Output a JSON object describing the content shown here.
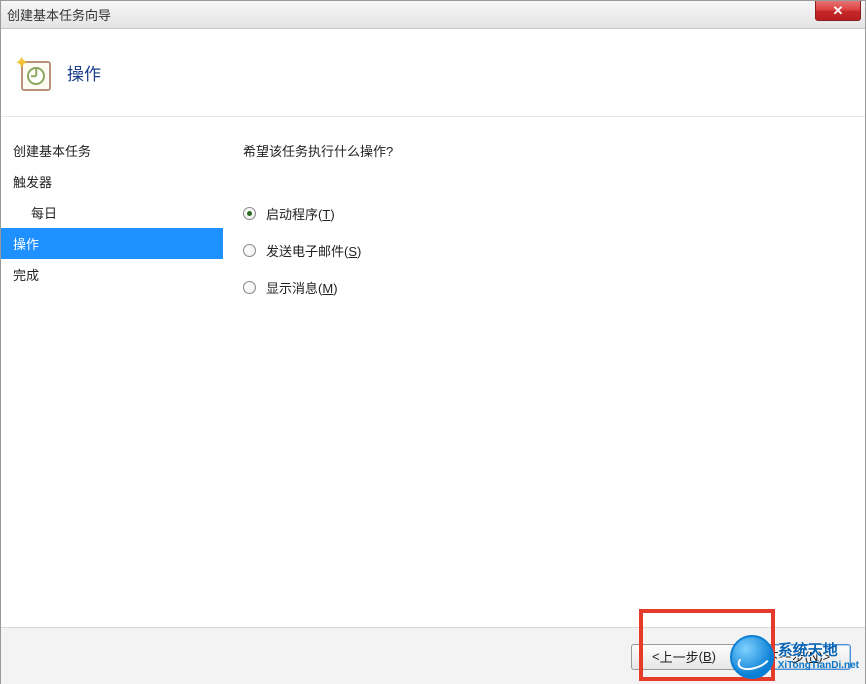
{
  "window": {
    "title": "创建基本任务向导"
  },
  "close_btn_glyph": "✕",
  "header": {
    "page_title": "操作"
  },
  "sidebar": {
    "items": [
      {
        "label": "创建基本任务",
        "sub": false,
        "active": false
      },
      {
        "label": "触发器",
        "sub": false,
        "active": false
      },
      {
        "label": "每日",
        "sub": true,
        "active": false
      },
      {
        "label": "操作",
        "sub": false,
        "active": true
      },
      {
        "label": "完成",
        "sub": false,
        "active": false
      }
    ]
  },
  "content": {
    "prompt": "希望该任务执行什么操作?",
    "options": [
      {
        "label": "启动程序",
        "accel": "T",
        "checked": true
      },
      {
        "label": "发送电子邮件",
        "accel": "S",
        "checked": false
      },
      {
        "label": "显示消息",
        "accel": "M",
        "checked": false
      }
    ]
  },
  "footer": {
    "back": {
      "prefix": "< ",
      "label": "上一步",
      "accel": "B",
      "suffix": ""
    },
    "next": {
      "prefix": "",
      "label": "下一步",
      "accel": "N",
      "suffix": " >"
    },
    "cancel_visible": false
  },
  "watermark": {
    "line1": "系统天地",
    "line2": "XiTongTianDi.net"
  }
}
